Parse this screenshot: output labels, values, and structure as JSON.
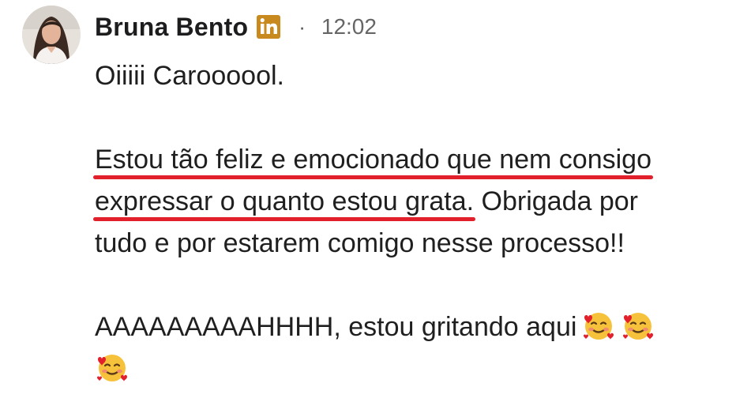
{
  "message_header": {
    "sender_name": "Bruna Bento",
    "badge_icon": "linkedin-icon",
    "separator": "·",
    "time": "12:02"
  },
  "message_body": {
    "line1": "Oiiiii Caroooool.",
    "line2_highlight": "Estou tão feliz e emocionado que nem consigo",
    "line3_highlight": "expressar o quanto estou grata.",
    "line3_rest": " Obrigada por",
    "line4": "tudo e por estarem comigo nesse processo!!",
    "line5": "AAAAAAAAAHHHH, estou gritando aqui",
    "emoji_icon": "smiling-face-with-hearts-icon"
  },
  "colors": {
    "underline": "#e2202c",
    "linkedin_badge": "#c8891e",
    "text": "#1f1f1f",
    "timestamp": "#666666"
  }
}
